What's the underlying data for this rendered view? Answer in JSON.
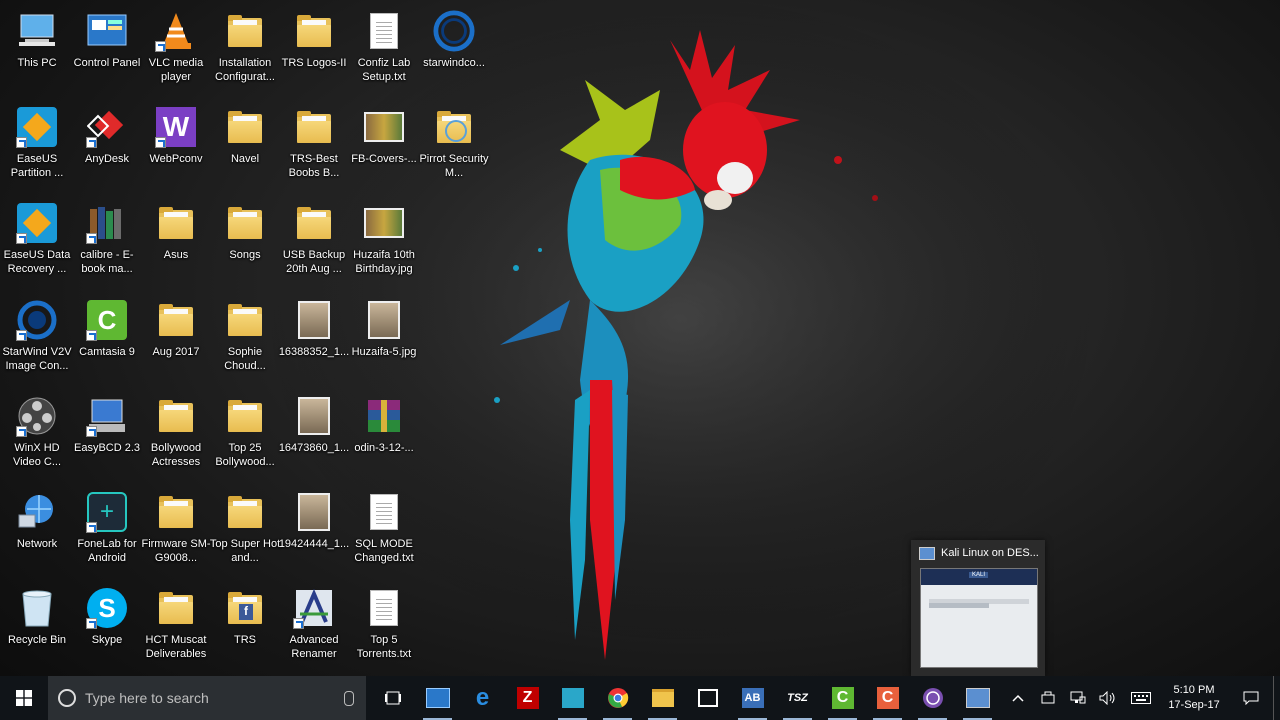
{
  "desktop_icons": [
    {
      "label": "This PC",
      "kind": "pc"
    },
    {
      "label": "EaseUS Partition ...",
      "kind": "app-easeus"
    },
    {
      "label": "EaseUS Data Recovery ...",
      "kind": "app-easeus-data"
    },
    {
      "label": "StarWind V2V Image Con...",
      "kind": "app-starwind"
    },
    {
      "label": "WinX HD Video C...",
      "kind": "app-winx"
    },
    {
      "label": "Network",
      "kind": "network"
    },
    {
      "label": "Recycle Bin",
      "kind": "recycle"
    },
    {
      "label": "Control Panel",
      "kind": "control"
    },
    {
      "label": "AnyDesk",
      "kind": "app-anydesk"
    },
    {
      "label": "calibre - E-book ma...",
      "kind": "app-calibre"
    },
    {
      "label": "Camtasia 9",
      "kind": "app-camtasia"
    },
    {
      "label": "EasyBCD 2.3",
      "kind": "app-easybcd"
    },
    {
      "label": "FoneLab for Android",
      "kind": "app-fonelab"
    },
    {
      "label": "Skype",
      "kind": "app-skype"
    },
    {
      "label": "VLC media player",
      "kind": "app-vlc"
    },
    {
      "label": "WebPconv",
      "kind": "app-webp"
    },
    {
      "label": "Asus",
      "kind": "folder"
    },
    {
      "label": "Aug 2017",
      "kind": "folder"
    },
    {
      "label": "Bollywood Actresses",
      "kind": "folder"
    },
    {
      "label": "Firmware SM-G9008...",
      "kind": "folder"
    },
    {
      "label": "HCT Muscat Deliverables",
      "kind": "folder"
    },
    {
      "label": "Installation Configurat...",
      "kind": "folder"
    },
    {
      "label": "Navel",
      "kind": "folder"
    },
    {
      "label": "Songs",
      "kind": "folder"
    },
    {
      "label": "Sophie Choud...",
      "kind": "folder"
    },
    {
      "label": "Top 25 Bollywood...",
      "kind": "folder"
    },
    {
      "label": "Top Super Hot and...",
      "kind": "folder"
    },
    {
      "label": "TRS",
      "kind": "folder-fb"
    },
    {
      "label": "TRS Logos-II",
      "kind": "folder"
    },
    {
      "label": "TRS-Best Boobs B...",
      "kind": "folder"
    },
    {
      "label": "USB Backup 20th Aug ...",
      "kind": "folder"
    },
    {
      "label": "16388352_1...",
      "kind": "photo"
    },
    {
      "label": "16473860_1...",
      "kind": "photo"
    },
    {
      "label": "19424444_1...",
      "kind": "photo"
    },
    {
      "label": "Advanced Renamer",
      "kind": "app-renamer"
    },
    {
      "label": "Confiz Lab Setup.txt",
      "kind": "txt"
    },
    {
      "label": "FB-Covers-...",
      "kind": "photo-wide"
    },
    {
      "label": "Huzaifa 10th Birthday.jpg",
      "kind": "photo-wide"
    },
    {
      "label": "Huzaifa-5.jpg",
      "kind": "photo"
    },
    {
      "label": "odin-3-12-...",
      "kind": "app-winrar"
    },
    {
      "label": "SQL MODE Changed.txt",
      "kind": "txt"
    },
    {
      "label": "Top 5 Torrents.txt",
      "kind": "txt"
    },
    {
      "label": "starwindco...",
      "kind": "app-starwind-ring"
    },
    {
      "label": "Pirrot Security M...",
      "kind": "folder-doc"
    }
  ],
  "taskbar": {
    "search_placeholder": "Type here to search",
    "apps": [
      {
        "name": "task-view-icon"
      },
      {
        "name": "control-panel-icon"
      },
      {
        "name": "edge-icon"
      },
      {
        "name": "filezilla-icon"
      },
      {
        "name": "box-app-icon"
      },
      {
        "name": "chrome-icon"
      },
      {
        "name": "file-explorer-icon"
      },
      {
        "name": "store-icon"
      },
      {
        "name": "ab-app-icon"
      },
      {
        "name": "tsz-icon"
      },
      {
        "name": "camtasia-icon"
      },
      {
        "name": "camtasia-recorder-icon"
      },
      {
        "name": "tor-icon"
      },
      {
        "name": "vm-icon"
      }
    ],
    "time": "5:10 PM",
    "date": "17-Sep-17"
  },
  "preview": {
    "title": "Kali Linux  on DES...",
    "thumb_logo": "KALI"
  },
  "colors": {
    "taskbar": "#101418",
    "search_box": "#2b2f33",
    "accent": "#9bb7d6"
  }
}
